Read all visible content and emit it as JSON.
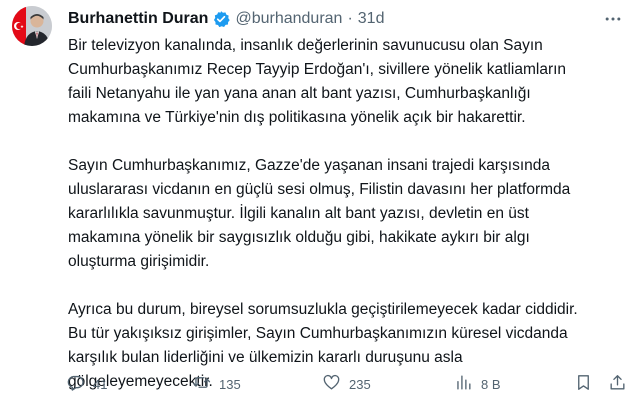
{
  "tweet": {
    "author_name": "Burhanettin Duran",
    "handle": "@burhanduran",
    "separator": "·",
    "time": "31d",
    "paragraphs": [
      "Bir televizyon kanalında, insanlık değerlerinin savunucusu olan Sayın\nCumhurbaşkanımız Recep Tayyip Erdoğan'ı, sivillere yönelik katliamların\nfaili Netanyahu ile yan yana anan alt bant yazısı, Cumhurbaşkanlığı\nmakamına ve Türkiye'nin dış politikasına yönelik açık bir hakarettir.",
      "Sayın Cumhurbaşkanımız, Gazze'de yaşanan insani trajedi karşısında\nuluslararası vicdanın en güçlü sesi olmuş, Filistin davasını her platformda\nkararlılıkla savunmuştur. İlgili kanalın alt bant yazısı, devletin en üst\nmakamına yönelik bir saygısızlık olduğu gibi, hakikate aykırı bir algı\noluşturma girişimidir.",
      "Ayrıca bu durum, bireysel sorumsuzlukla geçiştirilemeyecek kadar ciddidir.\nBu tür yakışıksız girişimler, Sayın Cumhurbaşkanımızın küresel vicdanda\nkarşılık bulan liderliğini ve ülkemizin kararlı duruşunu asla\ngölgeleyemeyecektir."
    ]
  },
  "actions": {
    "replies": "41",
    "reposts": "135",
    "likes": "235",
    "views": "8 B"
  },
  "icons": {
    "verified": "verified-badge-icon",
    "more": "more-options-icon",
    "reply": "reply-icon",
    "repost": "repost-icon",
    "like": "heart-icon",
    "views": "views-chart-icon",
    "bookmark": "bookmark-icon",
    "share": "share-icon"
  },
  "colors": {
    "text": "#0f1419",
    "muted": "#536471",
    "verified_blue": "#1d9bf0",
    "flag_red": "#e30a17"
  }
}
